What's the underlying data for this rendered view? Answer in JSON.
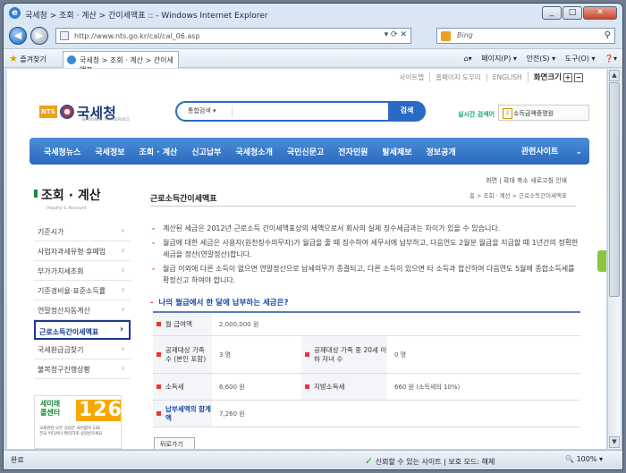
{
  "browser": {
    "title": "국세청 > 조회 · 계산 > 간이세액표 :: - Windows Internet Explorer",
    "url": "http://www.nts.go.kr/cal/cal_06.asp",
    "search_engine": "Bing",
    "favorites_label": "즐겨찾기",
    "tab_title": "국세청 > 조회 · 계산 > 간이세액표 ::",
    "tools": [
      "페이지(P) ▾",
      "안전(S) ▾",
      "도구(O) ▾",
      "❓▾"
    ],
    "status_left": "완료",
    "status_mid": "신뢰할 수 있는 사이트 | 보호 모드: 해제",
    "zoom": "100%"
  },
  "site": {
    "util_links": [
      "사이트맵",
      "홈페이지 도우미",
      "ENGLISH"
    ],
    "font_size_label": "화면크기",
    "logo_badge": "NTS",
    "logo_name": "국세청",
    "logo_sub": "NATIONAL TAX SERVICE",
    "search_select": "통합검색",
    "search_button": "검색",
    "realtime_label": "실시간 검색어",
    "realtime_keyword": "소득금액증명원",
    "gnb": [
      "국세청뉴스",
      "국세정보",
      "조회 · 계산",
      "신고납부",
      "국세청소개",
      "국민신문고",
      "전자민원",
      "탈세제보",
      "정보공개"
    ],
    "gnb_related": "관련사이트",
    "lnb_title": "조회 · 계산",
    "lnb_sub": "Inquiry & Account",
    "lnb_items": [
      "기준시가",
      "사업자과세유형·휴폐업",
      "부가가치세조회",
      "기준경비율·표준소득률",
      "연말정산자동계산",
      "근로소득간이세액표",
      "국세환급금찾기",
      "불복청구진행상황"
    ],
    "banner_top": "세미래\n콜센터",
    "banner_num": "126",
    "banner_text": "국세관련 모든 상담은 국번없이 126",
    "banner_text2": "전국 어디서나 편리하게 상담받으세요",
    "page_tools": "화면 | 확대  축소  새로고침  인쇄",
    "page_title": "근로소득간이세액표",
    "breadcrumb": "홈 > 조회 · 계산 > 근로소득간이세액표",
    "notes": [
      "계산된 세금은 2012년 근로소득 간이세액표상의 세액으로서 회사의 실제 징수세금과는 차이가 있을 수 있습니다.",
      "월급에 대한 세금은 사용자(원천징수의무자)가 월급을 줄 때 징수하여 세무서에 납부하고, 다음연도 2월분 월급을 지급할 때 1년간의 정확한 세금을 정산(연말정산)합니다.",
      "월급 이외에 다른 소득이 없으면 연말정산으로 납세의무가 종결되고, 다른 소득이 있으면 타 소득과 합산하여 다음연도 5월에 종합소득세를 확정신고 하여야 합니다."
    ],
    "question": "나의 월급에서 한 달에 납부하는 세금은?",
    "table": {
      "salary_label": "월 급여액",
      "salary_value": "2,000,000 원",
      "family_label": "공제대상 가족 수 (본인 포함)",
      "family_value": "3 명",
      "child_label": "공제대상 가족 중 20세 이하 자녀 수",
      "child_value": "0 명",
      "income_tax_label": "소득세",
      "income_tax_value": "6,600 원",
      "local_tax_label": "지방소득세",
      "local_tax_value": "660 원 (소득세의 10%)",
      "total_label": "납부세액의 합계액",
      "total_value": "7,260 원"
    },
    "back_button": "뒤로가기"
  }
}
